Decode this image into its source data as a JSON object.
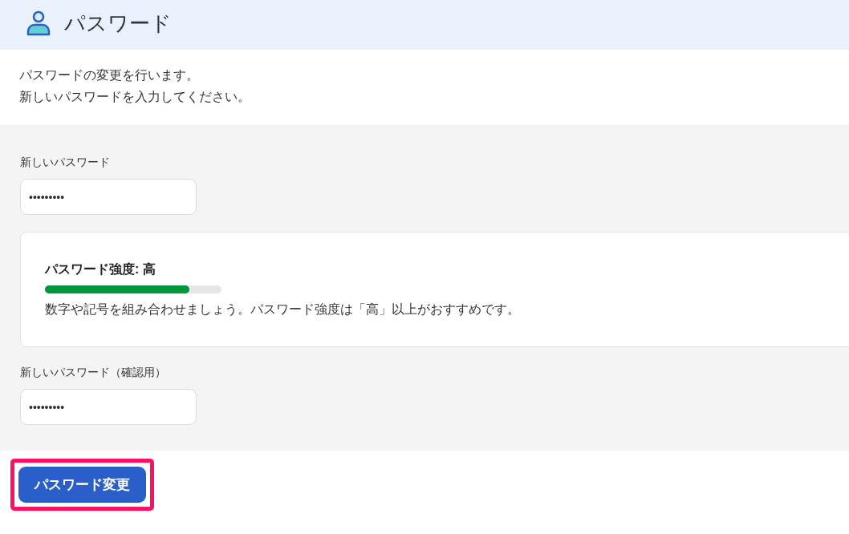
{
  "header": {
    "title": "パスワード"
  },
  "intro": [
    "パスワードの変更を行います。",
    "新しいパスワードを入力してください。"
  ],
  "form": {
    "fields": [
      {
        "kind": "input",
        "label": "新しいパスワード",
        "value": "•••••••••"
      },
      {
        "kind": "strength",
        "title": "パスワード強度: 高",
        "level": 0.82,
        "hint": "数字や記号を組み合わせましょう。パスワード強度は「高」以上がおすすめです。"
      },
      {
        "kind": "input",
        "label": "新しいパスワード（確認用）",
        "value": "•••••••••"
      }
    ]
  },
  "submit": {
    "label": "パスワード変更",
    "highlighted": true
  }
}
